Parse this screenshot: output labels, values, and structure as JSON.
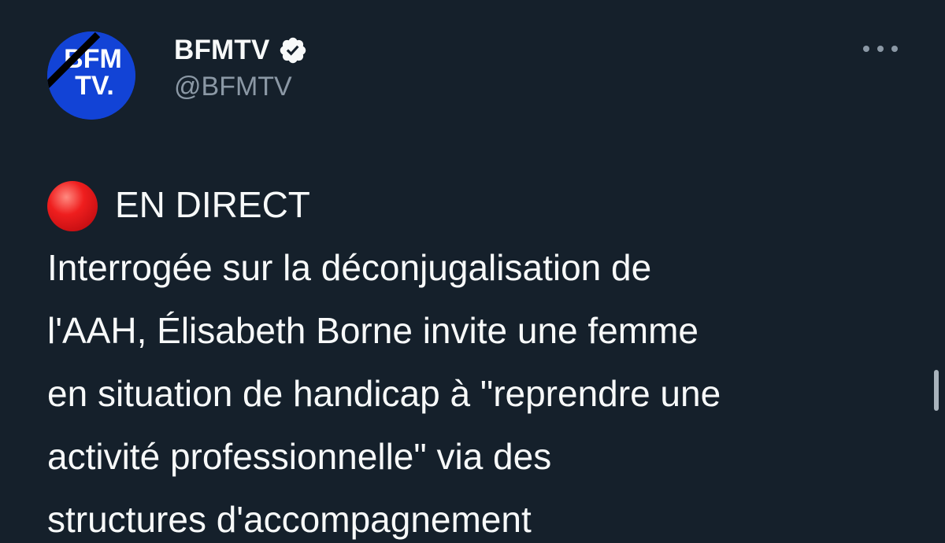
{
  "author": {
    "display_name": "BFMTV",
    "handle": "@BFMTV",
    "verified": true,
    "avatar": {
      "logo_line1": "BFM",
      "logo_line2": "TV.",
      "background": "#1243d6",
      "mourning_band": true
    }
  },
  "menu": {
    "icon": "more-horizontal-icon"
  },
  "tweet": {
    "live_icon": "red-circle-icon",
    "live_label": "EN DIRECT",
    "lines": [
      "Interrogée sur la déconjugalisation de",
      "l'AAH, Élisabeth Borne invite une femme",
      "en situation de handicap à \"reprendre une",
      "activité professionnelle\" via des",
      "structures d'accompagnement"
    ]
  },
  "colors": {
    "background": "#15202b",
    "text_primary": "#f7f9f9",
    "text_secondary": "#8b98a5",
    "live_red": "#ef1e1e"
  }
}
